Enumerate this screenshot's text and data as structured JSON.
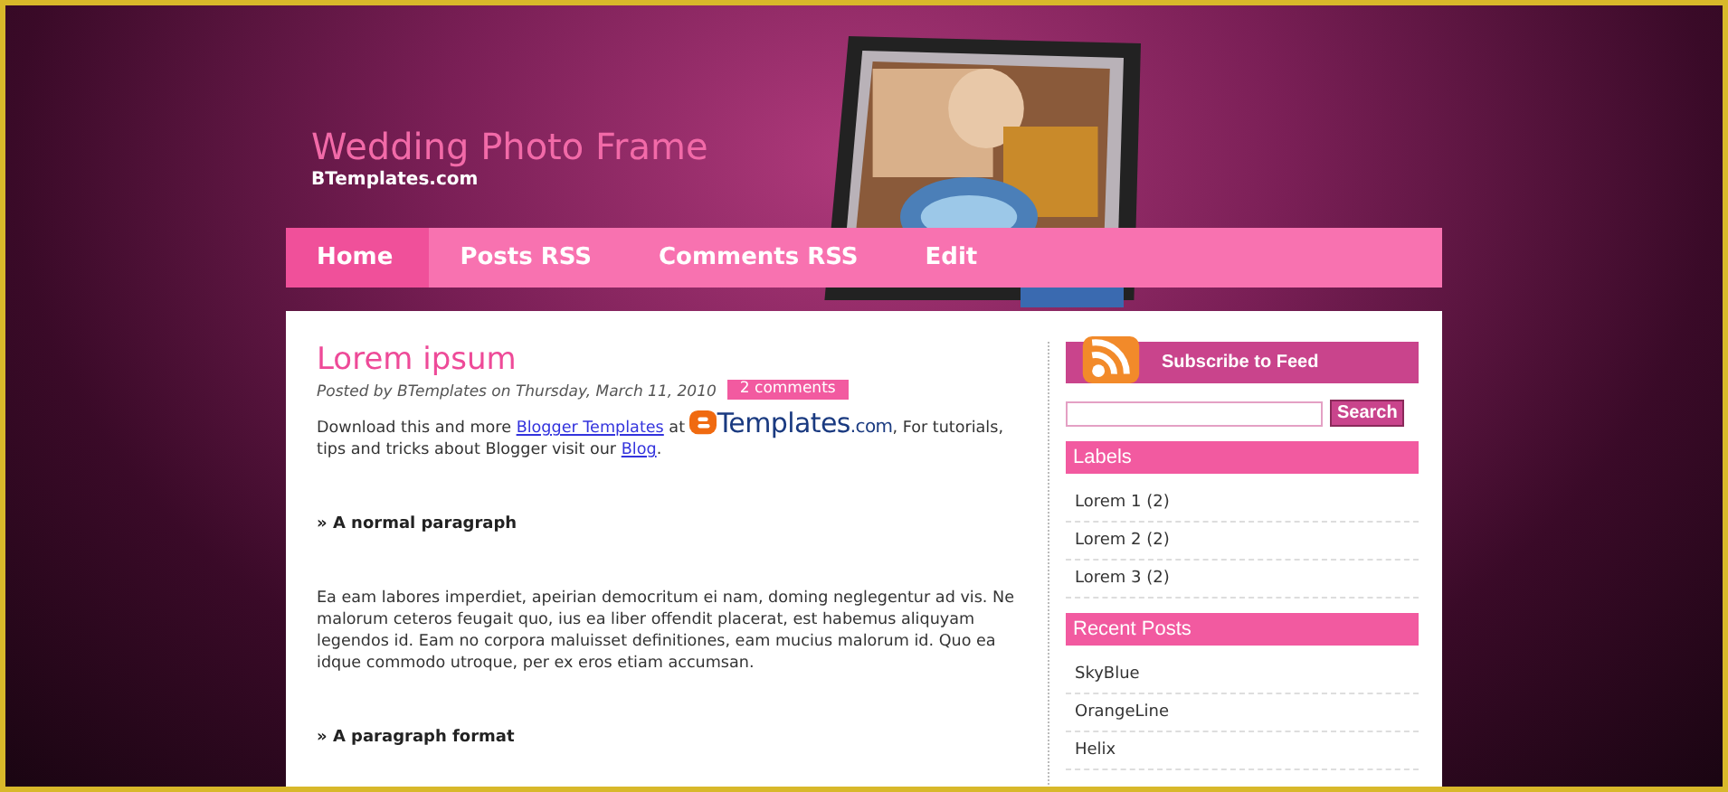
{
  "header": {
    "title": "Wedding Photo Frame",
    "subtitle": "BTemplates.com"
  },
  "nav": [
    {
      "label": "Home",
      "selected": true
    },
    {
      "label": "Posts RSS",
      "selected": false
    },
    {
      "label": "Comments RSS",
      "selected": false
    },
    {
      "label": "Edit",
      "selected": false
    }
  ],
  "post": {
    "title": "Lorem ipsum",
    "meta": "Posted by BTemplates on Thursday, March 11, 2010",
    "comments": "2 comments",
    "intro": [
      {
        "kind": "text",
        "text": "Download this and more "
      },
      {
        "kind": "link",
        "text": "Blogger Templates"
      },
      {
        "kind": "text",
        "text": " at "
      },
      {
        "kind": "logo",
        "text": "Templates",
        "suffix": ".com"
      },
      {
        "kind": "text",
        "text": ", For tutorials, tips and tricks about Blogger visit our "
      },
      {
        "kind": "link",
        "text": "Blog"
      },
      {
        "kind": "text",
        "text": "."
      }
    ],
    "sections": [
      {
        "heading": "» A normal paragraph",
        "body": "Ea eam labores imperdiet, apeirian democritum ei nam, doming neglegentur ad vis. Ne malorum ceteros feugait quo, ius ea liber offendit placerat, est habemus aliquyam legendos id. Eam no corpora maluisset definitiones, eam mucius malorum id. Quo ea idque commodo utroque, per ex eros etiam accumsan."
      },
      {
        "heading": "» A paragraph format"
      }
    ]
  },
  "sidebar": {
    "subscribe": "Subscribe to Feed",
    "search_button": "Search",
    "widgets": [
      {
        "title": "Labels",
        "items": [
          "Lorem 1 (2)",
          "Lorem 2 (2)",
          "Lorem 3 (2)"
        ]
      },
      {
        "title": "Recent Posts",
        "items": [
          "SkyBlue",
          "OrangeLine",
          "Helix"
        ]
      }
    ]
  }
}
